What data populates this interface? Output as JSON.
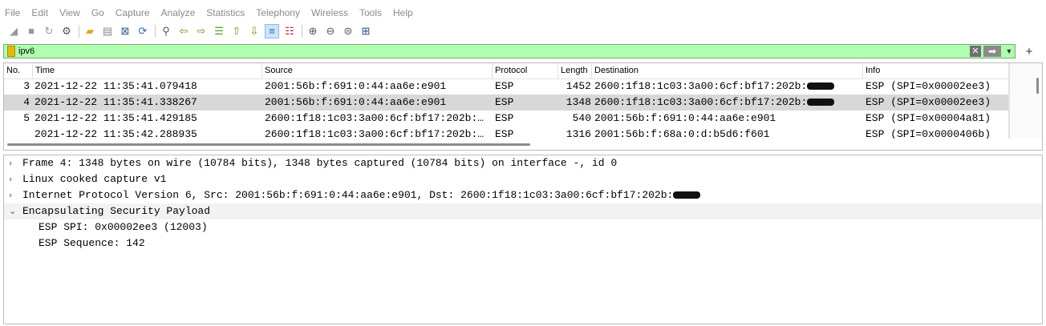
{
  "menu": [
    "File",
    "Edit",
    "View",
    "Go",
    "Capture",
    "Analyze",
    "Statistics",
    "Telephony",
    "Wireless",
    "Tools",
    "Help"
  ],
  "filter": {
    "value": "ipv6"
  },
  "packet_list": {
    "columns": [
      "No.",
      "Time",
      "Source",
      "Protocol",
      "Length",
      "Destination",
      "Info"
    ],
    "rows": [
      {
        "no": "3",
        "time": "2021-12-22 11:35:41.079418",
        "source": "2001:56b:f:691:0:44:aa6e:e901",
        "protocol": "ESP",
        "length": "1452",
        "destination": "2600:1f18:1c03:3a00:6cf:bf17:202b:",
        "info": "ESP (SPI=0x00002ee3)",
        "selected": false,
        "redacted": true
      },
      {
        "no": "4",
        "time": "2021-12-22 11:35:41.338267",
        "source": "2001:56b:f:691:0:44:aa6e:e901",
        "protocol": "ESP",
        "length": "1348",
        "destination": "2600:1f18:1c03:3a00:6cf:bf17:202b:",
        "info": "ESP (SPI=0x00002ee3)",
        "selected": true,
        "redacted": true
      },
      {
        "no": "5",
        "time": "2021-12-22 11:35:41.429185",
        "source": "2600:1f18:1c03:3a00:6cf:bf17:202b:…",
        "protocol": "ESP",
        "length": "540",
        "destination": "2001:56b:f:691:0:44:aa6e:e901",
        "info": "ESP (SPI=0x00004a81)",
        "selected": false,
        "redacted": false
      },
      {
        "no": "",
        "time": "2021-12-22 11:35:42.288935",
        "source": "2600:1f18:1c03:3a00:6cf:bf17:202b:…",
        "protocol": "ESP",
        "length": "1316",
        "destination": "2001:56b:f:68a:0:d:b5d6:f601",
        "info": "ESP (SPI=0x0000406b)",
        "selected": false,
        "redacted": false
      }
    ]
  },
  "details": [
    {
      "text": "Frame 4: 1348 bytes on wire (10784 bits), 1348 bytes captured (10784 bits) on interface -, id 0",
      "toggle": "›",
      "child": false,
      "expanded": false
    },
    {
      "text": "Linux cooked capture v1",
      "toggle": "›",
      "child": false,
      "expanded": false
    },
    {
      "text": "Internet Protocol Version 6, Src: 2001:56b:f:691:0:44:aa6e:e901, Dst: 2600:1f18:1c03:3a00:6cf:bf17:202b:",
      "toggle": "›",
      "child": false,
      "expanded": false,
      "redacted": true
    },
    {
      "text": "Encapsulating Security Payload",
      "toggle": "⌄",
      "child": false,
      "expanded": true
    },
    {
      "text": "ESP SPI: 0x00002ee3 (12003)",
      "toggle": "",
      "child": true,
      "expanded": false
    },
    {
      "text": "ESP Sequence: 142",
      "toggle": "",
      "child": true,
      "expanded": false
    }
  ]
}
